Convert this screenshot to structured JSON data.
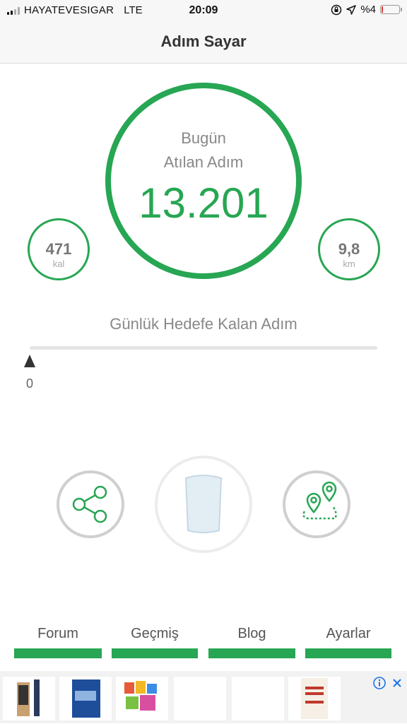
{
  "status_bar": {
    "carrier": "HAYATEVESIGAR",
    "network": "LTE",
    "time": "20:09",
    "battery": "%4",
    "colors": {
      "battery_low": "#e53935"
    }
  },
  "nav": {
    "title": "Adım Sayar"
  },
  "today": {
    "label_line1": "Bugün",
    "label_line2": "Atılan Adım",
    "steps": "13.201"
  },
  "calories": {
    "value": "471",
    "unit": "kal"
  },
  "distance": {
    "value": "9,8",
    "unit": "km"
  },
  "goal": {
    "label": "Günlük Hedefe Kalan Adım",
    "remaining": "0"
  },
  "actions": {
    "share_icon": "share-icon",
    "water_icon": "water-glass-icon",
    "route_icon": "map-route-icon"
  },
  "tabs": [
    {
      "label": "Forum"
    },
    {
      "label": "Geçmiş"
    },
    {
      "label": "Blog"
    },
    {
      "label": "Ayarlar"
    }
  ],
  "theme": {
    "accent": "#27a653",
    "text_muted": "#888888"
  }
}
